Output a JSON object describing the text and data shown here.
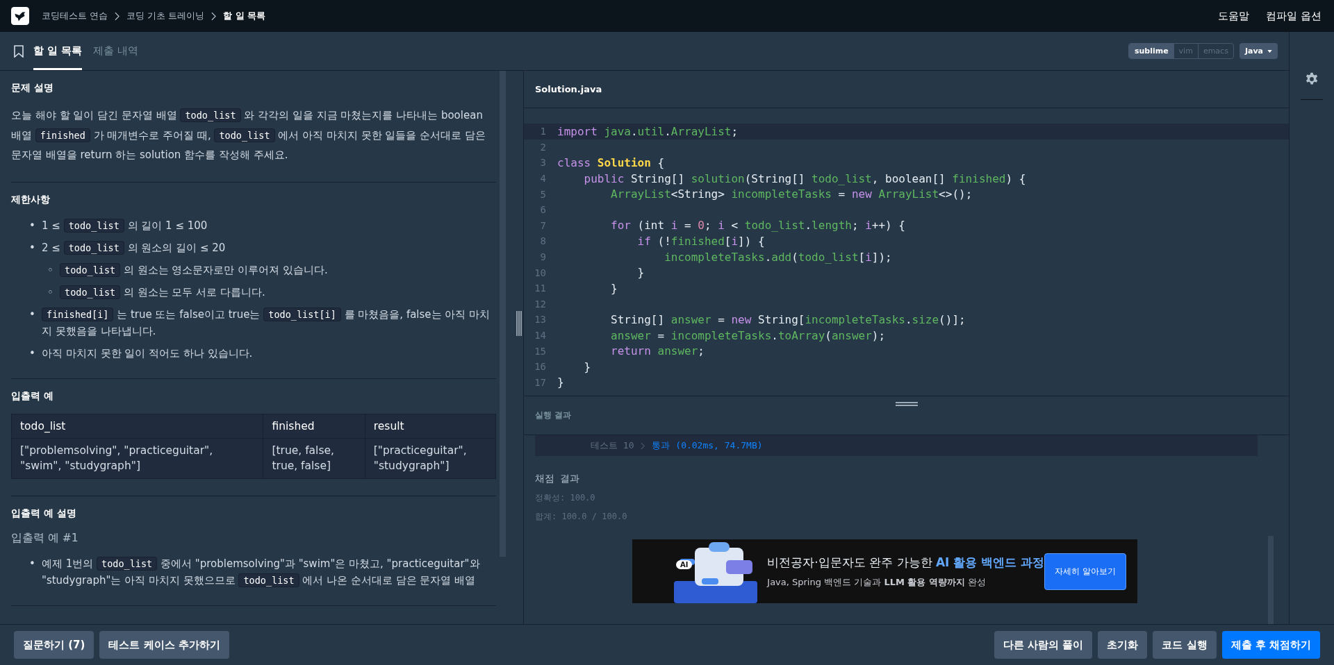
{
  "breadcrumb": [
    {
      "label": "코딩테스트 연습",
      "current": false
    },
    {
      "label": "코딩 기초 트레이닝",
      "current": false
    },
    {
      "label": "할 일 목록",
      "current": true
    }
  ],
  "header_links": [
    "도움말",
    "컴파일 옵션"
  ],
  "tabs": [
    {
      "label": "할 일 목록",
      "selected": true
    },
    {
      "label": "제출 내역",
      "selected": false
    }
  ],
  "sections": [
    {
      "title": "문제 설명",
      "blocks": [
        {
          "kind": "paragraph",
          "segments": [
            {
              "kind": "text",
              "text": "오늘 해야 할 일이 담긴 문자열 배열 "
            },
            {
              "kind": "code",
              "text": "todo_list"
            },
            {
              "kind": "text",
              "text": " 와 각각의 일을 지금 마쳤는지를 나타내는 boolean 배열 "
            },
            {
              "kind": "code",
              "text": "finished"
            },
            {
              "kind": "text",
              "text": " 가 매개변수로 주어질 때, "
            },
            {
              "kind": "code",
              "text": "todo_list"
            },
            {
              "kind": "text",
              "text": " 에서 아직 마치지 못한 일들을 순서대로 담은 문자열 배열을 return 하는 solution 함수를 작성해 주세요."
            }
          ]
        }
      ]
    },
    {
      "title": "제한사항",
      "blocks": [
        {
          "kind": "list",
          "items": [
            {
              "marker": "•",
              "segments": [
                {
                  "kind": "text",
                  "text": "1 ≤ "
                },
                {
                  "kind": "code",
                  "text": "todo_list"
                },
                {
                  "kind": "text",
                  "text": " 의 길이 1 ≤ 100"
                }
              ]
            },
            {
              "marker": "•",
              "segments": [
                {
                  "kind": "text",
                  "text": "2 ≤ "
                },
                {
                  "kind": "code",
                  "text": "todo_list"
                },
                {
                  "kind": "text",
                  "text": " 의 원소의 길이 ≤ 20"
                }
              ],
              "children": [
                {
                  "marker": "◦",
                  "segments": [
                    {
                      "kind": "code",
                      "text": "todo_list"
                    },
                    {
                      "kind": "text",
                      "text": " 의 원소는 영소문자로만 이루어져 있습니다."
                    }
                  ]
                },
                {
                  "marker": "◦",
                  "segments": [
                    {
                      "kind": "code",
                      "text": "todo_list"
                    },
                    {
                      "kind": "text",
                      "text": " 의 원소는 모두 서로 다릅니다."
                    }
                  ]
                }
              ]
            },
            {
              "marker": "•",
              "segments": [
                {
                  "kind": "code",
                  "text": "finished[i]"
                },
                {
                  "kind": "text",
                  "text": " 는 true 또는 false이고 true는 "
                },
                {
                  "kind": "code",
                  "text": "todo_list[i]"
                },
                {
                  "kind": "text",
                  "text": " 를 마쳤음을, false는 아직 마치지 못했음을 나타냅니다."
                }
              ]
            },
            {
              "marker": "•",
              "segments": [
                {
                  "kind": "text",
                  "text": "아직 마치지 못한 일이 적어도 하나 있습니다."
                }
              ]
            }
          ]
        }
      ]
    },
    {
      "title": "입출력 예",
      "blocks": [
        {
          "kind": "table",
          "columns": [
            "todo_list",
            "finished",
            "result"
          ],
          "rows": [
            [
              "[\"problemsolving\", \"practiceguitar\", \"swim\", \"studygraph\"]",
              "[true, false, true, false]",
              "[\"practiceguitar\", \"studygraph\"]"
            ]
          ]
        }
      ]
    },
    {
      "title": "입출력 예 설명",
      "blocks": [
        {
          "kind": "subtitle",
          "text": "입출력 예 #1"
        },
        {
          "kind": "list",
          "items": [
            {
              "marker": "•",
              "segments": [
                {
                  "kind": "text",
                  "text": "예제 1번의 "
                },
                {
                  "kind": "code",
                  "text": "todo_list"
                },
                {
                  "kind": "text",
                  "text": " 중에서 \"problemsolving\"과 \"swim\"은 마쳤고, \"practiceguitar\"와 \"studygraph\"는 아직 마치지 못했으므로 "
                },
                {
                  "kind": "code",
                  "text": "todo_list"
                },
                {
                  "kind": "text",
                  "text": " 에서 나온 순서대로 담은 문자열 배열"
                }
              ]
            }
          ]
        }
      ]
    }
  ],
  "editor": {
    "modes": [
      {
        "label": "sublime",
        "selected": true
      },
      {
        "label": "vim",
        "selected": false
      },
      {
        "label": "emacs",
        "selected": false
      }
    ],
    "language": "Java",
    "file": "Solution.java",
    "lines": [
      {
        "number": "1",
        "selected": true,
        "tokens": [
          {
            "kind": "kw",
            "text": "import "
          },
          {
            "kind": "id",
            "text": "java"
          },
          {
            "kind": "plain",
            "text": "."
          },
          {
            "kind": "id",
            "text": "util"
          },
          {
            "kind": "plain",
            "text": "."
          },
          {
            "kind": "id",
            "text": "ArrayList"
          },
          {
            "kind": "plain",
            "text": ";"
          }
        ]
      },
      {
        "number": "2",
        "selected": false
      },
      {
        "number": "3",
        "selected": false,
        "tokens": [
          {
            "kind": "kw",
            "text": "class "
          },
          {
            "kind": "cls",
            "text": "Solution"
          },
          {
            "kind": "plain",
            "text": " {"
          }
        ]
      },
      {
        "number": "4",
        "selected": false,
        "tokens": [
          {
            "kind": "kw",
            "text": "    public"
          },
          {
            "kind": "plain",
            "text": " String[] "
          },
          {
            "kind": "id",
            "text": "solution"
          },
          {
            "kind": "plain",
            "text": "(String[] "
          },
          {
            "kind": "id",
            "text": "todo_list"
          },
          {
            "kind": "plain",
            "text": ", boolean[] "
          },
          {
            "kind": "id",
            "text": "finished"
          },
          {
            "kind": "plain",
            "text": ") {"
          }
        ]
      },
      {
        "number": "5",
        "selected": false,
        "tokens": [
          {
            "kind": "id",
            "text": "        ArrayList"
          },
          {
            "kind": "plain",
            "text": "<String> "
          },
          {
            "kind": "id",
            "text": "incompleteTasks"
          },
          {
            "kind": "plain",
            "text": " = "
          },
          {
            "kind": "kw",
            "text": "new "
          },
          {
            "kind": "id",
            "text": "ArrayList"
          },
          {
            "kind": "plain",
            "text": "<>();"
          }
        ]
      },
      {
        "number": "6",
        "selected": false
      },
      {
        "number": "7",
        "selected": false,
        "tokens": [
          {
            "kind": "kw",
            "text": "        for"
          },
          {
            "kind": "plain",
            "text": " (int "
          },
          {
            "kind": "var",
            "text": "i"
          },
          {
            "kind": "plain",
            "text": " = "
          },
          {
            "kind": "num",
            "text": "0"
          },
          {
            "kind": "plain",
            "text": "; "
          },
          {
            "kind": "var",
            "text": "i"
          },
          {
            "kind": "plain",
            "text": " < "
          },
          {
            "kind": "id",
            "text": "todo_list"
          },
          {
            "kind": "plain",
            "text": "."
          },
          {
            "kind": "id",
            "text": "length"
          },
          {
            "kind": "plain",
            "text": "; "
          },
          {
            "kind": "var",
            "text": "i"
          },
          {
            "kind": "plain",
            "text": "++) {"
          }
        ]
      },
      {
        "number": "8",
        "selected": false,
        "tokens": [
          {
            "kind": "kw",
            "text": "            if"
          },
          {
            "kind": "plain",
            "text": " (!"
          },
          {
            "kind": "id",
            "text": "finished"
          },
          {
            "kind": "plain",
            "text": "["
          },
          {
            "kind": "var",
            "text": "i"
          },
          {
            "kind": "plain",
            "text": "]) {"
          }
        ]
      },
      {
        "number": "9",
        "selected": false,
        "tokens": [
          {
            "kind": "id",
            "text": "                incompleteTasks"
          },
          {
            "kind": "plain",
            "text": "."
          },
          {
            "kind": "id",
            "text": "add"
          },
          {
            "kind": "plain",
            "text": "("
          },
          {
            "kind": "id",
            "text": "todo_list"
          },
          {
            "kind": "plain",
            "text": "["
          },
          {
            "kind": "var",
            "text": "i"
          },
          {
            "kind": "plain",
            "text": "]);"
          }
        ]
      },
      {
        "number": "10",
        "selected": false,
        "tokens": [
          {
            "kind": "plain",
            "text": "            }"
          }
        ]
      },
      {
        "number": "11",
        "selected": false,
        "tokens": [
          {
            "kind": "plain",
            "text": "        }"
          }
        ]
      },
      {
        "number": "12",
        "selected": false
      },
      {
        "number": "13",
        "selected": false,
        "tokens": [
          {
            "kind": "plain",
            "text": "        String[] "
          },
          {
            "kind": "id",
            "text": "answer"
          },
          {
            "kind": "plain",
            "text": " = "
          },
          {
            "kind": "kw",
            "text": "new"
          },
          {
            "kind": "plain",
            "text": " String["
          },
          {
            "kind": "id",
            "text": "incompleteTasks"
          },
          {
            "kind": "plain",
            "text": "."
          },
          {
            "kind": "id",
            "text": "size"
          },
          {
            "kind": "plain",
            "text": "()];"
          }
        ]
      },
      {
        "number": "14",
        "selected": false,
        "tokens": [
          {
            "kind": "id",
            "text": "        answer"
          },
          {
            "kind": "plain",
            "text": " = "
          },
          {
            "kind": "id",
            "text": "incompleteTasks"
          },
          {
            "kind": "plain",
            "text": "."
          },
          {
            "kind": "id",
            "text": "toArray"
          },
          {
            "kind": "plain",
            "text": "("
          },
          {
            "kind": "id",
            "text": "answer"
          },
          {
            "kind": "plain",
            "text": ");"
          }
        ]
      },
      {
        "number": "15",
        "selected": false,
        "tokens": [
          {
            "kind": "kw",
            "text": "        return "
          },
          {
            "kind": "id",
            "text": "answer"
          },
          {
            "kind": "plain",
            "text": ";"
          }
        ]
      },
      {
        "number": "16",
        "selected": false,
        "tokens": [
          {
            "kind": "plain",
            "text": "    }"
          }
        ]
      },
      {
        "number": "17",
        "selected": false,
        "tokens": [
          {
            "kind": "plain",
            "text": "}"
          }
        ]
      }
    ]
  },
  "results": {
    "title": "실행 결과",
    "tests": [
      {
        "label": "테스트 10",
        "result": "통과 (0.02ms, 74.7MB)"
      }
    ],
    "grading_title": "채점 결과",
    "grading_lines": [
      "정확성: 100.0",
      "합계: 100.0 / 100.0"
    ]
  },
  "ad": {
    "illustration_label": "AI",
    "headline": "비전공자·입문자도 완주 가능한",
    "headline_highlight": "AI 활용 백엔드 과정",
    "subline": "Java, Spring 백엔드 기술과 **LLM 활용 역량까지** 완성",
    "button": "자세히 알아보기"
  },
  "left_buttons": [
    "질문하기 (7)",
    "테스트 케이스 추가하기"
  ],
  "right_buttons": [
    {
      "label": "다른 사람의 풀이",
      "kind": "secondary"
    },
    {
      "label": "초기화",
      "kind": "secondary"
    },
    {
      "label": "코드 실행",
      "kind": "secondary"
    },
    {
      "label": "제출 후 채점하기",
      "kind": "primary"
    }
  ]
}
